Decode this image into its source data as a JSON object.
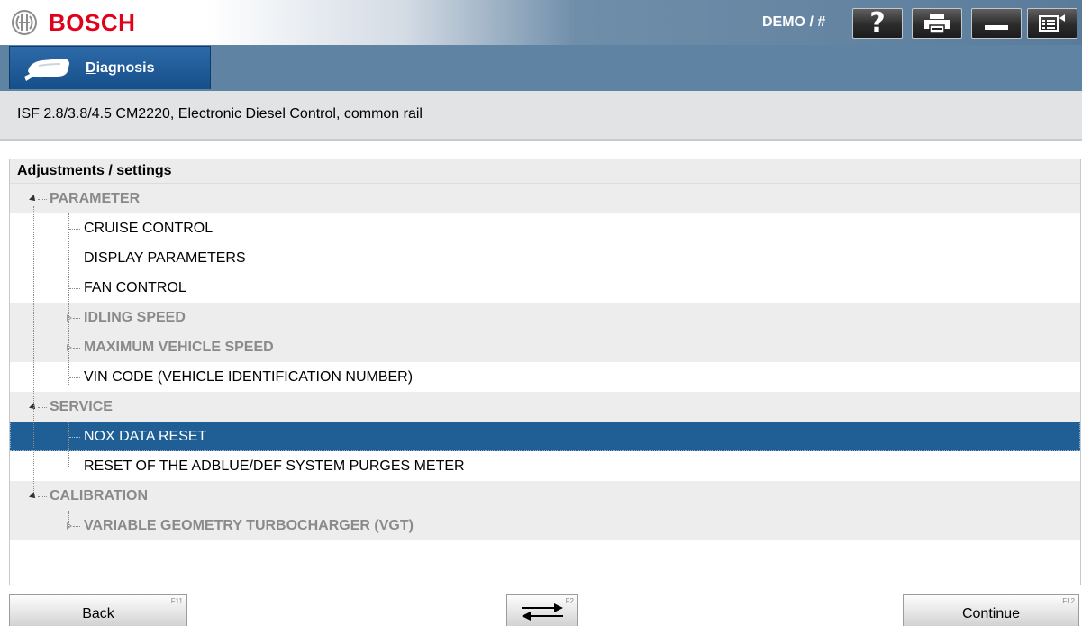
{
  "header": {
    "brand": "BOSCH",
    "demo_label": "DEMO / #",
    "buttons": [
      {
        "name": "help",
        "icon": "question-mark-icon",
        "label": "?"
      },
      {
        "name": "print",
        "icon": "printer-icon"
      },
      {
        "name": "minimize",
        "icon": "minimize-icon"
      },
      {
        "name": "menu",
        "icon": "menu-icon"
      }
    ]
  },
  "nav": {
    "tab_label_first": "D",
    "tab_label_rest": "iagnosis"
  },
  "vehicle": {
    "description": "ISF 2.8/3.8/4.5 CM2220, Electronic Diesel Control, common rail"
  },
  "tree": {
    "title": "Adjustments / settings",
    "rows": [
      {
        "label": "PARAMETER",
        "kind": "category"
      },
      {
        "label": "CRUISE CONTROL",
        "kind": "leaf"
      },
      {
        "label": "DISPLAY PARAMETERS",
        "kind": "leaf"
      },
      {
        "label": "FAN CONTROL",
        "kind": "leaf"
      },
      {
        "label": "IDLING SPEED",
        "kind": "group"
      },
      {
        "label": "MAXIMUM VEHICLE SPEED",
        "kind": "group"
      },
      {
        "label": "VIN CODE (VEHICLE IDENTIFICATION NUMBER)",
        "kind": "leaf"
      },
      {
        "label": "SERVICE",
        "kind": "category"
      },
      {
        "label": "NOX DATA RESET",
        "kind": "leaf",
        "selected": true
      },
      {
        "label": "RESET OF THE ADBLUE/DEF SYSTEM PURGES METER",
        "kind": "leaf"
      },
      {
        "label": "CALIBRATION",
        "kind": "category"
      },
      {
        "label": "VARIABLE GEOMETRY TURBOCHARGER (VGT)",
        "kind": "group"
      }
    ]
  },
  "footer": {
    "back": {
      "label": "Back",
      "key": "F11"
    },
    "switch": {
      "icon": "swap-arrows-icon",
      "key": "F2"
    },
    "continue": {
      "label": "Continue",
      "key": "F12"
    }
  },
  "colors": {
    "brand_red": "#e2001a",
    "band_blue": "#5f83a3",
    "selection_blue": "#1f5f95",
    "category_text": "#8a8a8a"
  }
}
